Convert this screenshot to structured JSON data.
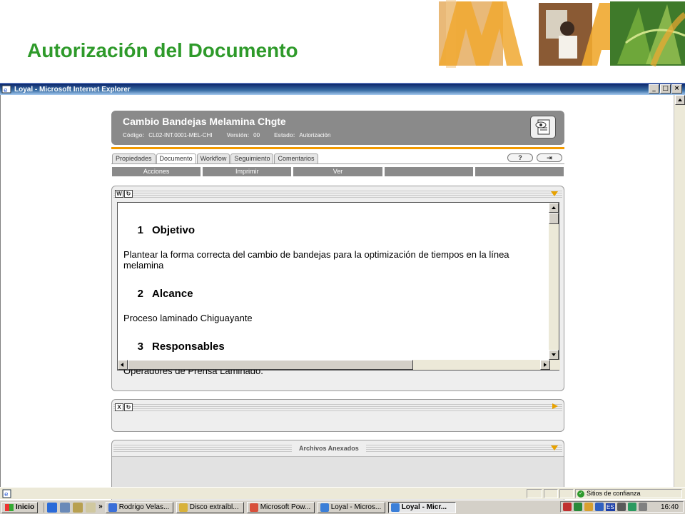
{
  "slide": {
    "title": "Autorización del Documento"
  },
  "window": {
    "title": "Loyal - Microsoft Internet Explorer",
    "min": "_",
    "max": "□",
    "close": "×"
  },
  "document": {
    "title": "Cambio Bandejas Melamina Chgte",
    "codigo_label": "Código:",
    "codigo": "CL02-INT.0001-MEL-CHI",
    "version_label": "Versión:",
    "version": "00",
    "estado_label": "Estado:",
    "estado": "Autorización"
  },
  "tabs": [
    {
      "label": "Propiedades"
    },
    {
      "label": "Documento"
    },
    {
      "label": "Workflow"
    },
    {
      "label": "Seguimiento"
    },
    {
      "label": "Comentarios"
    }
  ],
  "help_label": "?",
  "exit_label": "⇥",
  "actions": [
    "Acciones",
    "Imprimir",
    "Ver",
    "",
    ""
  ],
  "doc_panel": {
    "word_icon": "W",
    "refresh_icon": "↻",
    "sections": [
      {
        "num": "1",
        "title": "Objetivo",
        "text": "Plantear la forma correcta del cambio de bandejas para la optimización de tiempos en la línea melamina"
      },
      {
        "num": "2",
        "title": "Alcance",
        "text": "Proceso laminado Chiguayante"
      },
      {
        "num": "3",
        "title": "Responsables",
        "text": "Operadores de Prensa Laminado."
      }
    ]
  },
  "second_panel": {
    "excel_icon": "X",
    "refresh_icon": "↻"
  },
  "annex": {
    "label": "Archivos Anexados"
  },
  "status": {
    "zone": "Sitios de confianza"
  },
  "taskbar": {
    "start": "Inicio",
    "more": "»",
    "tasks": [
      {
        "label": "Rodrigo Velas...",
        "color": "#3b6fd8"
      },
      {
        "label": "Disco extraíbl...",
        "color": "#d8b23b"
      },
      {
        "label": "Microsoft Pow...",
        "color": "#d8503b"
      },
      {
        "label": "Loyal - Micros...",
        "color": "#3b7fd8"
      },
      {
        "label": "Loyal - Micr...",
        "color": "#3b7fd8"
      }
    ],
    "lang": "ES",
    "clock": "16:40"
  },
  "colors": {
    "title_green": "#2e9a2a",
    "header_gray": "#8a8a8a",
    "accent_orange": "#f39a00",
    "triangle_amber": "#e8a200"
  }
}
